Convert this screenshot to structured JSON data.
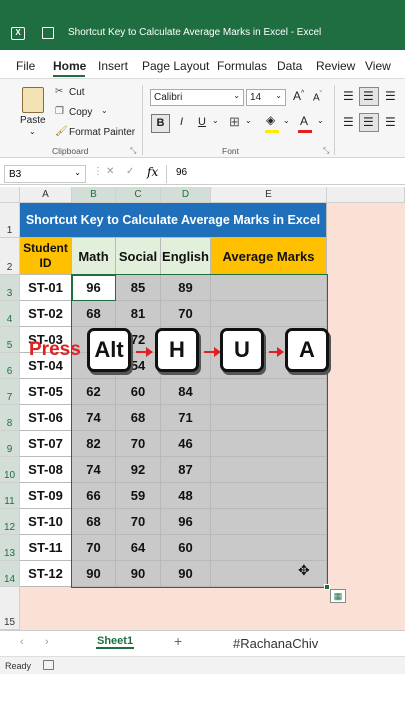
{
  "app": {
    "title": "Shortcut Key to Calculate Average Marks in Excel  -  Excel"
  },
  "menu": [
    "File",
    "Home",
    "Insert",
    "Page Layout",
    "Formulas",
    "Data",
    "Review",
    "View"
  ],
  "ribbon": {
    "paste": "Paste",
    "cut": "Cut",
    "copy": "Copy",
    "format_painter": "Format Painter",
    "clipboard_group": "Clipboard",
    "font_name": "Calibri",
    "font_size": "14",
    "font_group": "Font",
    "bold": "B",
    "italic": "I",
    "underline": "U",
    "font_color_letter": "A"
  },
  "formula_bar": {
    "name_box": "B3",
    "fx": "fx",
    "value": "96"
  },
  "columns": [
    "A",
    "B",
    "C",
    "D",
    "E"
  ],
  "rows": [
    "1",
    "2",
    "3",
    "4",
    "5",
    "6",
    "7",
    "8",
    "9",
    "10",
    "11",
    "12",
    "13",
    "14",
    "15"
  ],
  "sheet": {
    "title": "Shortcut Key to Calculate Average Marks in Excel",
    "headers": [
      "Student ID",
      "Math",
      "Social",
      "English",
      "Average Marks"
    ],
    "data": [
      [
        "ST-01",
        "96",
        "85",
        "89"
      ],
      [
        "ST-02",
        "68",
        "81",
        "70"
      ],
      [
        "ST-03",
        "",
        "72",
        ""
      ],
      [
        "ST-04",
        "",
        "54",
        ""
      ],
      [
        "ST-05",
        "62",
        "60",
        "84"
      ],
      [
        "ST-06",
        "74",
        "68",
        "71"
      ],
      [
        "ST-07",
        "82",
        "70",
        "46"
      ],
      [
        "ST-08",
        "74",
        "92",
        "87"
      ],
      [
        "ST-09",
        "66",
        "59",
        "48"
      ],
      [
        "ST-10",
        "68",
        "70",
        "96"
      ],
      [
        "ST-11",
        "70",
        "64",
        "60"
      ],
      [
        "ST-12",
        "90",
        "90",
        "90"
      ]
    ]
  },
  "overlay": {
    "press": "Press",
    "keys": [
      "Alt",
      "H",
      "U",
      "A"
    ]
  },
  "tabs": {
    "sheet1": "Sheet1",
    "add": "+",
    "watermark": "#RachanaChiv"
  },
  "status": {
    "ready": "Ready"
  },
  "colors": {
    "excel_green": "#1e6e42",
    "title_fill": "#1f6fba",
    "header_fill": "#ffc000",
    "subject_fill": "#e2efda",
    "press_red": "#e02020"
  }
}
